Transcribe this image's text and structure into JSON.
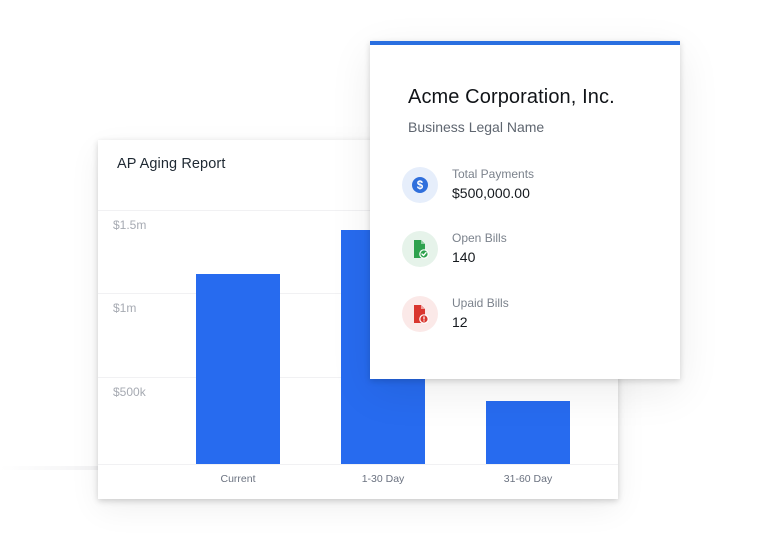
{
  "report": {
    "title": "AP Aging Report",
    "chart_data": {
      "type": "bar",
      "categories": [
        "Current",
        "1-30 Day",
        "31-60 Day"
      ],
      "values": [
        1120000,
        1380000,
        370000
      ],
      "yticks": [
        "$1.5m",
        "$1m",
        "$500k"
      ],
      "ylim": [
        0,
        1500000
      ],
      "color": "#276bef"
    }
  },
  "business": {
    "name": "Acme Corporation, Inc.",
    "subtitle": "Business Legal Name",
    "accent": "#2a6fe0",
    "stats": [
      {
        "label": "Total Payments",
        "value": "$500,000.00",
        "icon": "dollar-icon",
        "icon_color": "#2f6fdc",
        "icon_bg": "#e6eefb"
      },
      {
        "label": "Open Bills",
        "value": "140",
        "icon": "document-check-icon",
        "icon_color": "#2ea24e",
        "icon_bg": "#e6f3ea"
      },
      {
        "label": "Upaid Bills",
        "value": "12",
        "icon": "document-alert-icon",
        "icon_color": "#d9362f",
        "icon_bg": "#fbe9e8"
      }
    ]
  }
}
